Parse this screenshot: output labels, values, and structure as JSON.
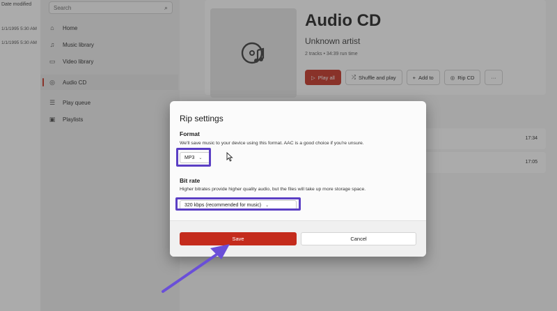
{
  "explorer": {
    "header": "Date modified",
    "dates": [
      "1/1/1995 5:30 AM",
      "1/1/1995 5:30 AM"
    ]
  },
  "sidebar": {
    "search_placeholder": "Search",
    "items": [
      {
        "label": "Home",
        "icon": "home-icon",
        "glyph": "⌂"
      },
      {
        "label": "Music library",
        "icon": "music-note-icon",
        "glyph": "♫"
      },
      {
        "label": "Video library",
        "icon": "video-icon",
        "glyph": "▭"
      },
      {
        "label": "Audio CD",
        "icon": "disc-icon",
        "glyph": "◎"
      },
      {
        "label": "Play queue",
        "icon": "queue-icon",
        "glyph": "☰"
      },
      {
        "label": "Playlists",
        "icon": "playlist-icon",
        "glyph": "▣"
      }
    ]
  },
  "album": {
    "title": "Audio CD",
    "artist": "Unknown artist",
    "meta": "2 tracks • 34:39 run time",
    "actions": {
      "play_all": "Play all",
      "shuffle": "Shuffle and play",
      "add_to": "Add to",
      "rip_cd": "Rip CD",
      "more": "···"
    }
  },
  "tracks": [
    {
      "duration": "17:34"
    },
    {
      "duration": "17:05"
    }
  ],
  "dialog": {
    "title": "Rip settings",
    "format_title": "Format",
    "format_desc": "We'll save music to your device using this format. AAC is a good choice if you're unsure.",
    "format_value": "MP3",
    "bitrate_title": "Bit rate",
    "bitrate_desc": "Higher bitrates provide higher quality audio, but the files will take up more storage space.",
    "bitrate_value": "320 kbps (recommended for music)",
    "save_label": "Save",
    "cancel_label": "Cancel"
  },
  "colors": {
    "accent": "#c42b1c",
    "highlight": "#5b3fc4"
  }
}
